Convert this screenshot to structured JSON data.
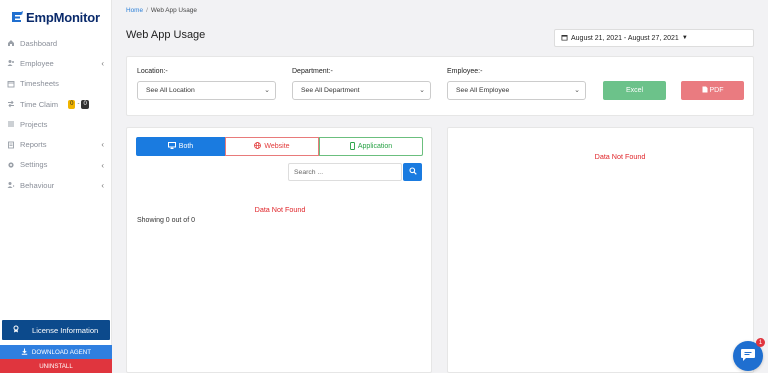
{
  "brand": {
    "name": "EmpMonitor",
    "color": "#0a2a6b"
  },
  "sidebar": {
    "items": [
      {
        "label": "Dashboard",
        "icon": "home-icon",
        "chevron": false
      },
      {
        "label": "Employee",
        "icon": "users-icon",
        "chevron": true
      },
      {
        "label": "Timesheets",
        "icon": "calendar-icon",
        "chevron": false
      },
      {
        "label": "Time Claim",
        "icon": "swap-icon",
        "chevron": false,
        "badges": [
          "0",
          "0"
        ]
      },
      {
        "label": "Projects",
        "icon": "list-icon",
        "chevron": false
      },
      {
        "label": "Reports",
        "icon": "report-icon",
        "chevron": true
      },
      {
        "label": "Settings",
        "icon": "gear-icon",
        "chevron": true
      },
      {
        "label": "Behaviour",
        "icon": "behaviour-icon",
        "chevron": true
      }
    ],
    "license_label": "License Information",
    "download_label": "DOWNLOAD AGENT",
    "uninstall_label": "UNINSTALL"
  },
  "breadcrumb": {
    "home": "Home",
    "separator": "/",
    "current": "Web App Usage"
  },
  "page_title": "Web App Usage",
  "date_range": "August 21, 2021 - August 27, 2021",
  "filters": {
    "location": {
      "label": "Location:-",
      "value": "See All Location"
    },
    "department": {
      "label": "Department:-",
      "value": "See All Department"
    },
    "employee": {
      "label": "Employee:-",
      "value": "See All Employee"
    },
    "excel_label": "Excel",
    "pdf_label": "PDF"
  },
  "tabs": {
    "both": "Both",
    "website": "Website",
    "application": "Application"
  },
  "search": {
    "placeholder": "Search ..."
  },
  "left_panel": {
    "empty_message": "Data Not Found",
    "showing_text": "Showing 0 out of 0"
  },
  "right_panel": {
    "empty_message": "Data Not Found"
  },
  "chat": {
    "badge_count": "1"
  },
  "colors": {
    "primary": "#1a7be0",
    "excel": "#6cc28a",
    "pdf": "#ea7b80",
    "error": "#e0252a",
    "license_bg": "#0c4a8c",
    "uninstall_bg": "#e0353e"
  }
}
